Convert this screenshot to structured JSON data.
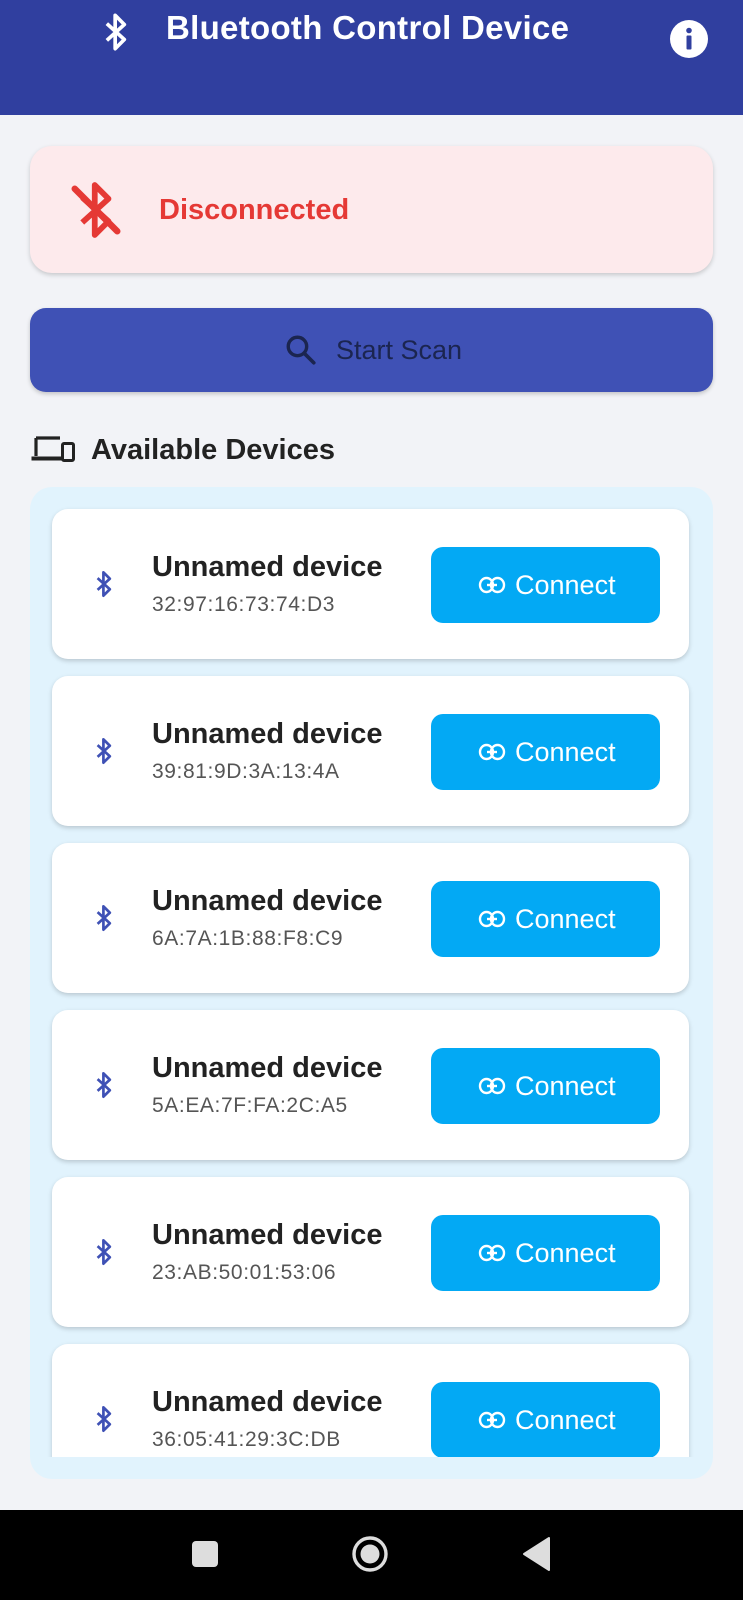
{
  "app_bar": {
    "title": "Bluetooth Control Device",
    "icons": [
      "bluetooth-icon",
      "info-icon"
    ],
    "color": "#303f9f"
  },
  "status": {
    "text": "Disconnected",
    "icon": "bluetooth-disabled-icon",
    "color": "#e53935",
    "background": "#fdeaec"
  },
  "scan_button": {
    "label": "Start Scan",
    "icon": "search-icon",
    "color": "#3f51b5"
  },
  "devices_section": {
    "title": "Available Devices",
    "icon": "devices-icon"
  },
  "devices": [
    {
      "name": "Unnamed device",
      "address": "32:97:16:73:74:D3",
      "action": "Connect"
    },
    {
      "name": "Unnamed device",
      "address": "39:81:9D:3A:13:4A",
      "action": "Connect"
    },
    {
      "name": "Unnamed device",
      "address": "6A:7A:1B:88:F8:C9",
      "action": "Connect"
    },
    {
      "name": "Unnamed device",
      "address": "5A:EA:7F:FA:2C:A5",
      "action": "Connect"
    },
    {
      "name": "Unnamed device",
      "address": "23:AB:50:01:53:06",
      "action": "Connect"
    },
    {
      "name": "Unnamed device",
      "address": "36:05:41:29:3C:DB",
      "action": "Connect"
    }
  ],
  "accent_colors": {
    "connect_button": "#03a9f4",
    "device_icon": "#3f51b5",
    "list_background": "#e1f3fd"
  },
  "nav_bar": {
    "buttons": [
      "recents-button",
      "home-button",
      "back-button"
    ]
  }
}
